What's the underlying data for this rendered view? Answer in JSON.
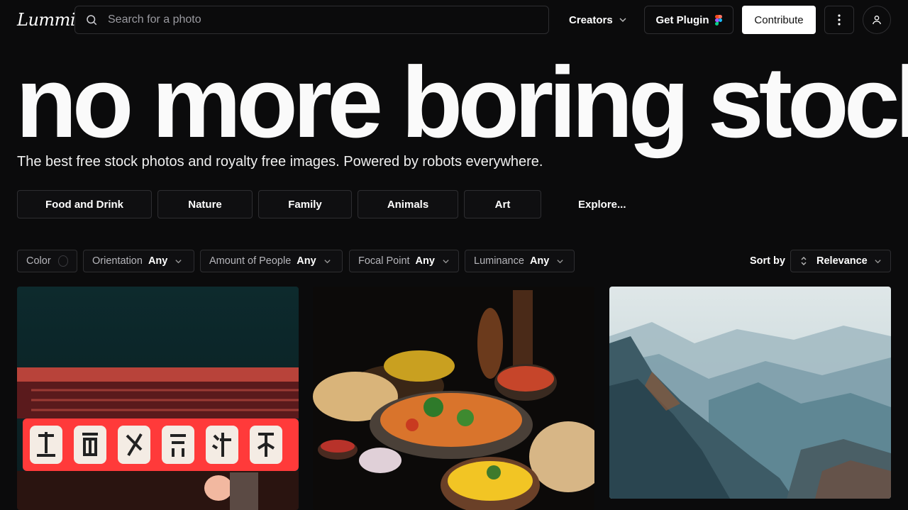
{
  "header": {
    "logo_text": "Lummi",
    "search_placeholder": "Search for a photo",
    "creators_label": "Creators",
    "plugin_label": "Get Plugin",
    "contribute_label": "Contribute"
  },
  "hero": {
    "title": "no more boring stock",
    "subtitle": "The best free stock photos and royalty free images. Powered by robots everywhere."
  },
  "categories": [
    {
      "label": "Food and Drink"
    },
    {
      "label": "Nature"
    },
    {
      "label": "Family"
    },
    {
      "label": "Animals"
    },
    {
      "label": "Art"
    }
  ],
  "explore_label": "Explore...",
  "filters": {
    "color_label": "Color",
    "orientation": {
      "label": "Orientation",
      "value": "Any"
    },
    "people": {
      "label": "Amount of People",
      "value": "Any"
    },
    "focal": {
      "label": "Focal Point",
      "value": "Any"
    },
    "luminance": {
      "label": "Luminance",
      "value": "Any"
    }
  },
  "sort": {
    "label": "Sort by",
    "value": "Relevance"
  },
  "photos": [
    {
      "subject": "neon-sign-street"
    },
    {
      "subject": "indian-food-table"
    },
    {
      "subject": "misty-mountains"
    }
  ]
}
